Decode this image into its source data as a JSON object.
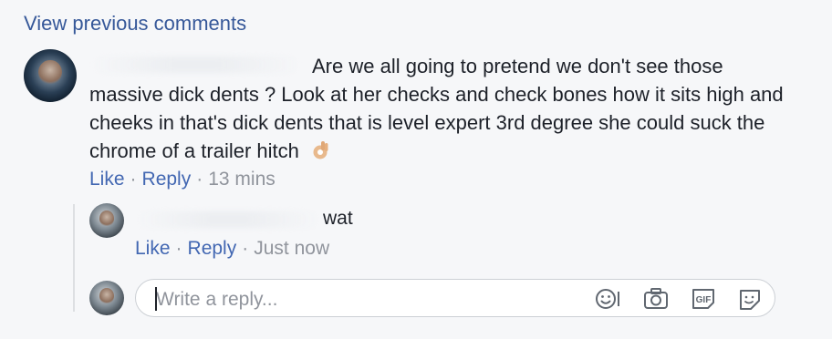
{
  "view_previous": "View previous comments",
  "comment": {
    "text_line1": "Are we all going to pretend we don't see those",
    "text_rest": "massive dick dents ? Look at her checks and check bones how it sits high and cheeks in that's dick dents that is level expert 3rd degree she could suck the chrome of a trailer hitch",
    "emoji_icon": "ok-hand-icon",
    "like": "Like",
    "reply": "Reply",
    "time": "13 mins"
  },
  "reply": {
    "text": "wat",
    "like": "Like",
    "reply": "Reply",
    "time": "Just now"
  },
  "composer": {
    "placeholder": "Write a reply...",
    "icons": [
      "emoji-icon",
      "camera-icon",
      "gif-icon",
      "sticker-icon"
    ]
  },
  "colors": {
    "link": "#4267b2",
    "meta": "#90949c",
    "text": "#1d2129"
  }
}
